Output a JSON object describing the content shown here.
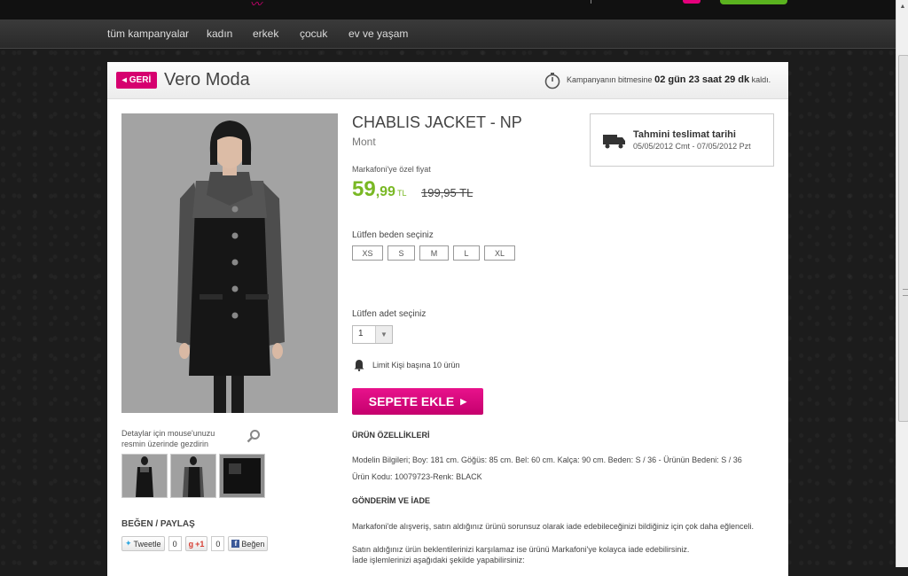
{
  "nav": {
    "items": [
      "tüm kampanyalar",
      "kadın",
      "erkek",
      "çocuk",
      "ev ve yaşam"
    ]
  },
  "header": {
    "back_label": "GERİ",
    "brand": "Vero Moda",
    "countdown_prefix": "Kampanyanın bitmesine",
    "countdown_value": "02 gün 23 saat 29 dk",
    "countdown_suffix": "kaldı."
  },
  "gallery": {
    "zoom_hint": "Detaylar için mouse'unuzu resmin üzerinde gezdirin",
    "thumbnail_count": 3
  },
  "share": {
    "title": "BEĞEN / PAYLAŞ",
    "tweet_label": "Tweetle",
    "tweet_count": "0",
    "gplus_label": "+1",
    "gplus_count": "0",
    "like_label": "Beğen"
  },
  "product": {
    "title": "CHABLIS JACKET - NP",
    "category": "Mont",
    "special_price_label": "Markafoni'ye özel fiyat",
    "price_main": "59",
    "price_cents": ",99",
    "currency": "TL",
    "old_price": "199,95 TL",
    "size_label": "Lütfen beden seçiniz",
    "sizes": [
      "XS",
      "S",
      "M",
      "L",
      "XL"
    ],
    "qty_label": "Lütfen adet seçiniz",
    "qty_value": "1",
    "limit_text": "Limit Kişi başına 10 ürün",
    "add_to_cart": "SEPETE EKLE"
  },
  "shipping": {
    "title": "Tahmini teslimat tarihi",
    "dates": "05/05/2012 Cmt - 07/05/2012 Pzt"
  },
  "details": {
    "features_title": "ÜRÜN ÖZELLİKLERİ",
    "features_line1": "Modelin Bilgileri; Boy: 181 cm. Göğüs: 85 cm. Bel: 60 cm. Kalça: 90 cm. Beden: S / 36 - Ürünün Bedeni: S / 36",
    "features_line2": "Ürün Kodu: 10079723-Renk: BLACK",
    "returns_title": "GÖNDERİM VE İADE",
    "returns_line1": "Markafoni'de alışveriş, satın aldığınız ürünü sorunsuz olarak iade edebileceğinizi bildiğiniz için çok daha eğlenceli.",
    "returns_line2": "Satın aldığınız ürün beklentilerinizi karşılamaz ise ürünü Markafoni'ye kolayca iade edebilirsiniz.",
    "returns_line3": "İade işlemlerinizi aşağıdaki şekilde yapabilirsiniz:"
  },
  "colors": {
    "accent_pink": "#d6006f",
    "price_green": "#79b824",
    "page_bg": "#1c1c1c"
  },
  "icons": [
    "back-arrow-icon",
    "stopwatch-icon",
    "magnifier-icon",
    "twitter-icon",
    "gplus-icon",
    "facebook-icon",
    "truck-icon",
    "bell-icon",
    "play-arrow-icon"
  ]
}
